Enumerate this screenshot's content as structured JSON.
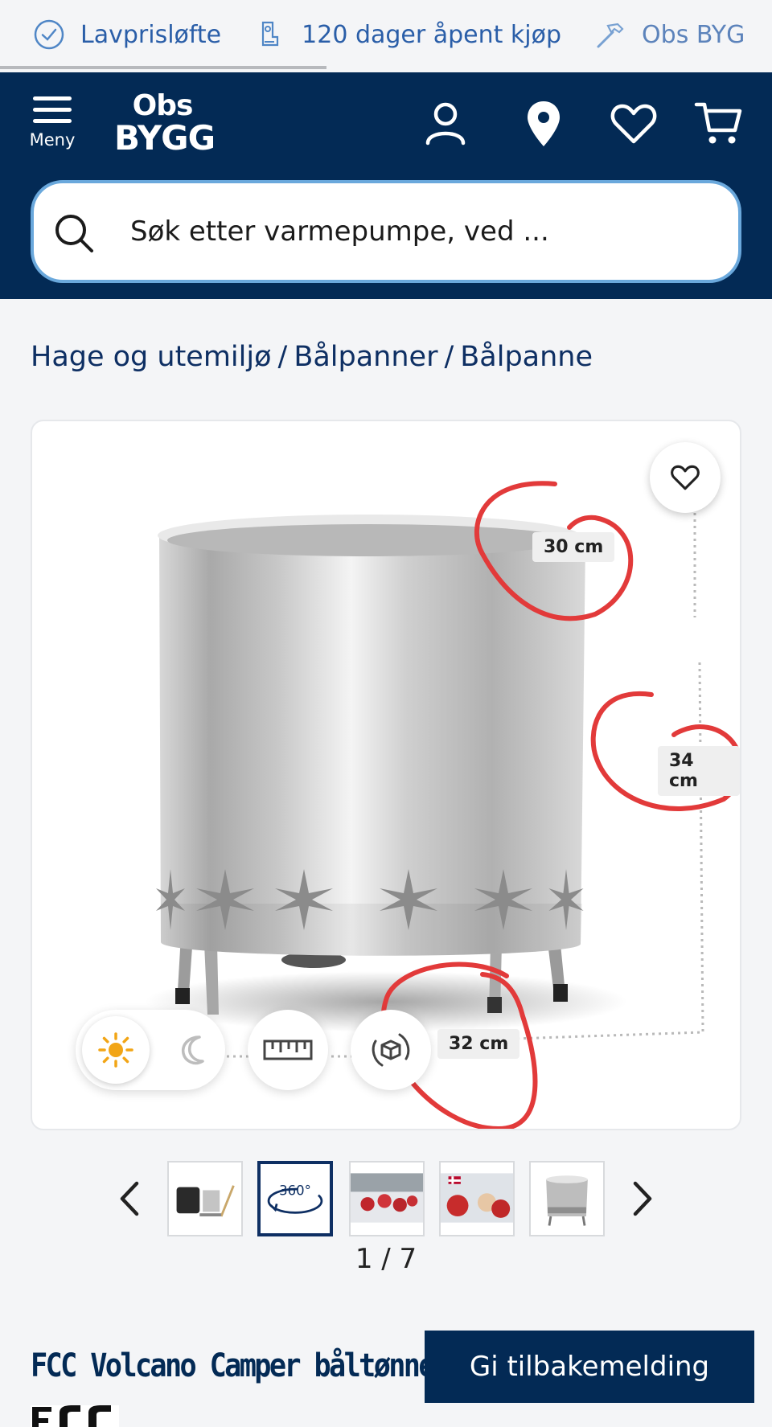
{
  "usp": [
    {
      "icon": "check-circle-icon",
      "label": "Lavprisløfte"
    },
    {
      "icon": "receipt-icon",
      "label": "120 dager åpent kjøp"
    },
    {
      "icon": "hammer-icon",
      "label": "Obs BYG"
    }
  ],
  "header": {
    "menu_label": "Meny",
    "logo_line1": "Obs",
    "logo_line2": "BYGG",
    "bg_color": "#032a55"
  },
  "search": {
    "placeholder": "Søk etter varmepumpe, ved ..."
  },
  "breadcrumb": [
    "Hage og utemiljø",
    "Bålpanner",
    "Bålpanne"
  ],
  "product_viewer": {
    "dimensions": [
      "30 cm",
      "34 cm",
      "32 cm"
    ],
    "tools": [
      "sun-icon",
      "moon-icon",
      "ruler-icon",
      "3d-view-icon"
    ]
  },
  "gallery": {
    "thumb_360_label": "360°",
    "counter": "1 / 7"
  },
  "product": {
    "title": "FCC Volcano Camper båltønne"
  },
  "feedback_button": "Gi tilbakemelding"
}
